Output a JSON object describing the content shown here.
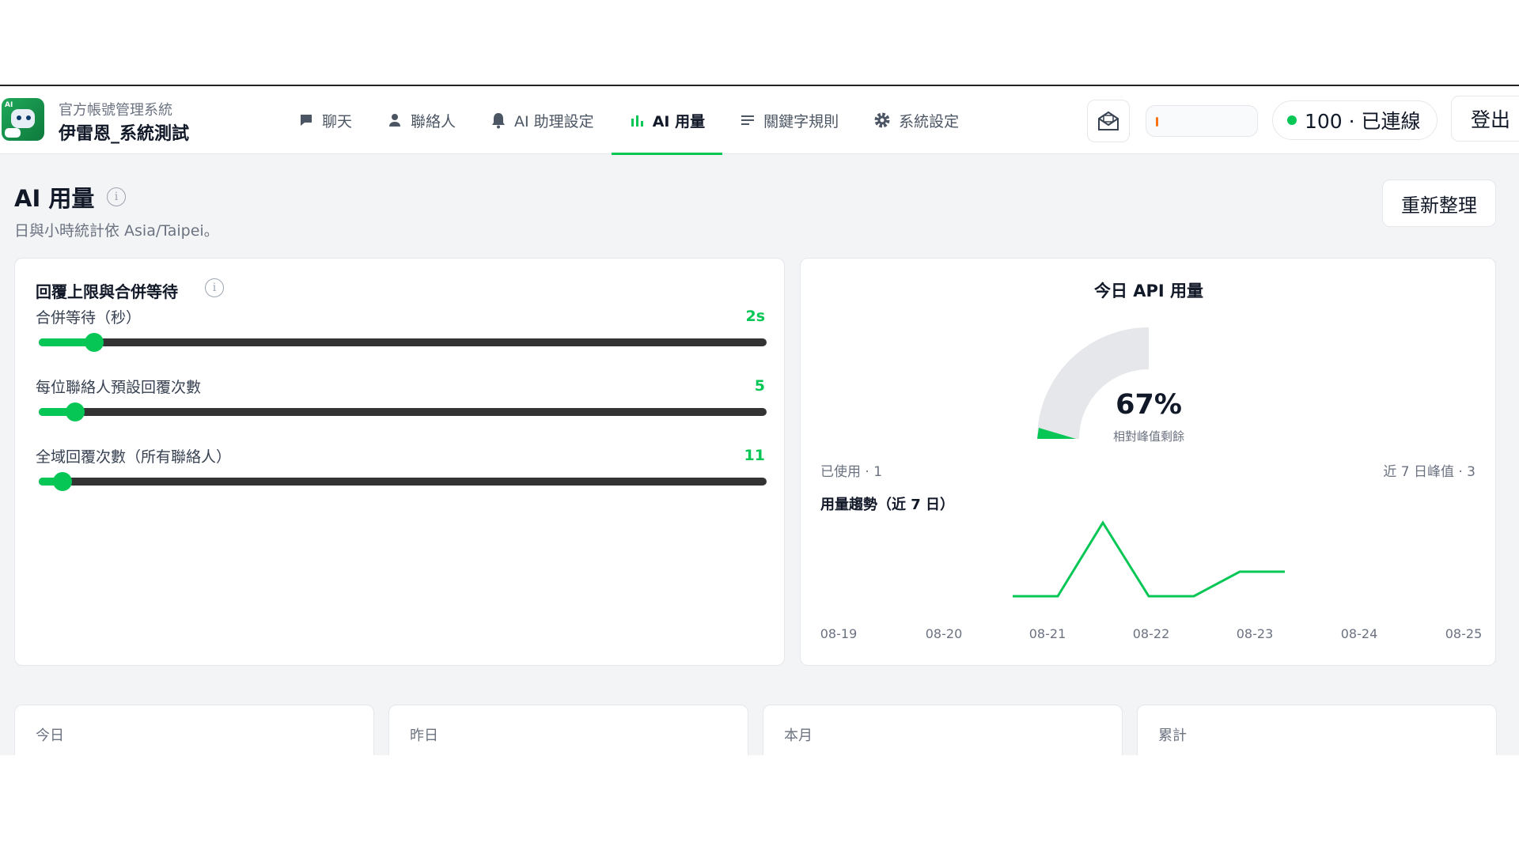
{
  "header": {
    "brand_sub": "官方帳號管理系統",
    "brand_main": "伊雷恩_系統測試",
    "nav": [
      {
        "label": "聊天",
        "icon": "chat-icon"
      },
      {
        "label": "聯絡人",
        "icon": "person-icon"
      },
      {
        "label": "AI 助理設定",
        "icon": "bell-icon"
      },
      {
        "label": "AI 用量",
        "icon": "bar-chart-icon",
        "active": true
      },
      {
        "label": "關鍵字規則",
        "icon": "list-icon"
      },
      {
        "label": "系統設定",
        "icon": "gear-icon"
      }
    ],
    "status_text": "100 · 已連線",
    "logout_label": "登出"
  },
  "page": {
    "title": "AI 用量",
    "subtitle": "日與小時統計依 Asia/Taipei。",
    "refresh_label": "重新整理"
  },
  "limits": {
    "title": "回覆上限與合併等待",
    "sliders": [
      {
        "label": "合併等待（秒）",
        "value_text": "2s",
        "fraction": 0.076
      },
      {
        "label": "每位聯絡人預設回覆次數",
        "value_text": "5",
        "fraction": 0.05
      },
      {
        "label": "全域回覆次數（所有聯絡人）",
        "value_text": "11",
        "fraction": 0.033
      }
    ]
  },
  "usage": {
    "title": "今日 API 用量",
    "gauge_percent": "67%",
    "gauge_fraction": 0.67,
    "gauge_caption": "相對峰值剩餘",
    "used_text": "已使用 · 1",
    "peak_text": "近 7 日峰值 · 3",
    "trend_title": "用量趨勢（近 7 日）",
    "colors": {
      "accent": "#06c755",
      "gauge_track": "#e5e7eb"
    }
  },
  "chart_data": {
    "type": "line",
    "categories": [
      "08-19",
      "08-20",
      "08-21",
      "08-22",
      "08-23",
      "08-24",
      "08-25"
    ],
    "series_points": [
      {
        "x": "08-21",
        "y": 0
      },
      {
        "x": "08-21",
        "y": 0
      },
      {
        "x": "08-21",
        "y": 3
      },
      {
        "x": "08-22",
        "y": 0
      },
      {
        "x": "08-22",
        "y": 0
      },
      {
        "x": "08-23",
        "y": 1
      },
      {
        "x": "08-23",
        "y": 1
      }
    ],
    "values": [
      0,
      0,
      3,
      0,
      1
    ],
    "ylim": [
      0,
      3
    ]
  },
  "stats": [
    {
      "label": "今日"
    },
    {
      "label": "昨日"
    },
    {
      "label": "本月"
    },
    {
      "label": "累計"
    }
  ]
}
